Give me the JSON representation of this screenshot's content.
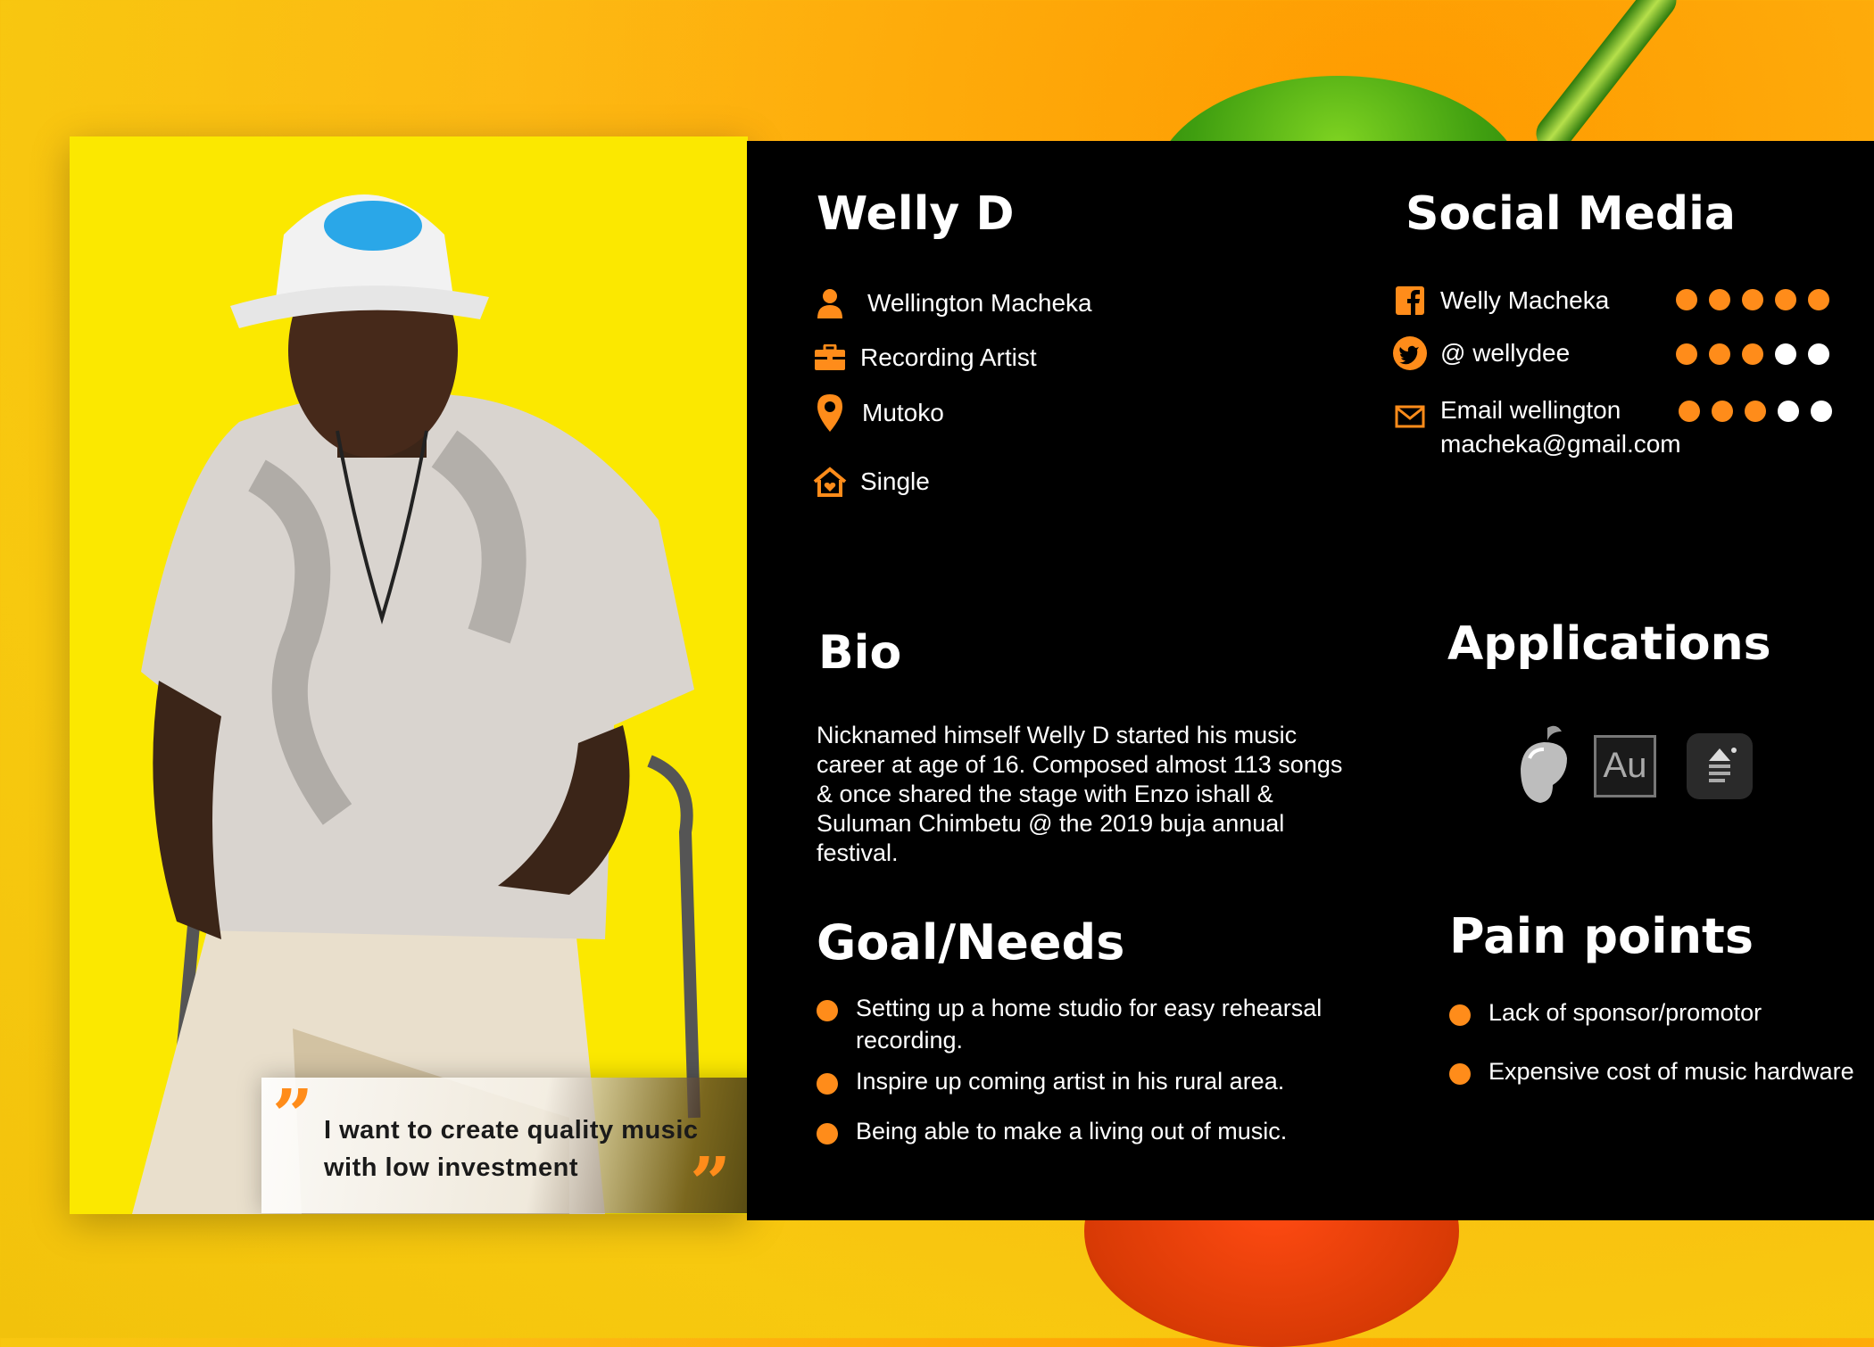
{
  "quote": {
    "text": "I want to create quality music with low investment"
  },
  "profile": {
    "name": "Welly D",
    "full_name": "Wellington Macheka",
    "occupation": "Recording Artist",
    "location": "Mutoko",
    "status": "Single"
  },
  "social": {
    "title": "Social Media",
    "items": [
      {
        "icon": "facebook-icon",
        "label": "Welly Macheka",
        "level": 5,
        "max": 5
      },
      {
        "icon": "twitter-icon",
        "label": "@ wellydee",
        "level": 3,
        "max": 5
      },
      {
        "icon": "email-icon",
        "label": "Email wellington\nmacheka@gmail.com",
        "level": 3,
        "max": 5
      }
    ]
  },
  "bio": {
    "title": "Bio",
    "text": "Nicknamed himself Welly D started his music career at age of 16. Composed almost 113 songs & once shared the stage with Enzo ishall & Suluman Chimbetu @ the 2019 buja annual festival."
  },
  "applications": {
    "title": "Applications",
    "items": [
      {
        "icon": "fl-studio-icon"
      },
      {
        "icon": "adobe-audition-icon",
        "label": "Au"
      },
      {
        "icon": "filmora-icon"
      }
    ]
  },
  "goals": {
    "title": "Goal/Needs",
    "items": [
      "Setting up a home studio for easy rehearsal recording.",
      "Inspire up coming artist in his rural area.",
      "Being able to make a living out of music."
    ]
  },
  "pain_points": {
    "title": "Pain points",
    "items": [
      "Lack of sponsor/promotor",
      "Expensive cost of music hardware"
    ]
  },
  "colors": {
    "accent": "#ff8c1a",
    "card": "#000000",
    "photo_bg": "#fbe800"
  }
}
